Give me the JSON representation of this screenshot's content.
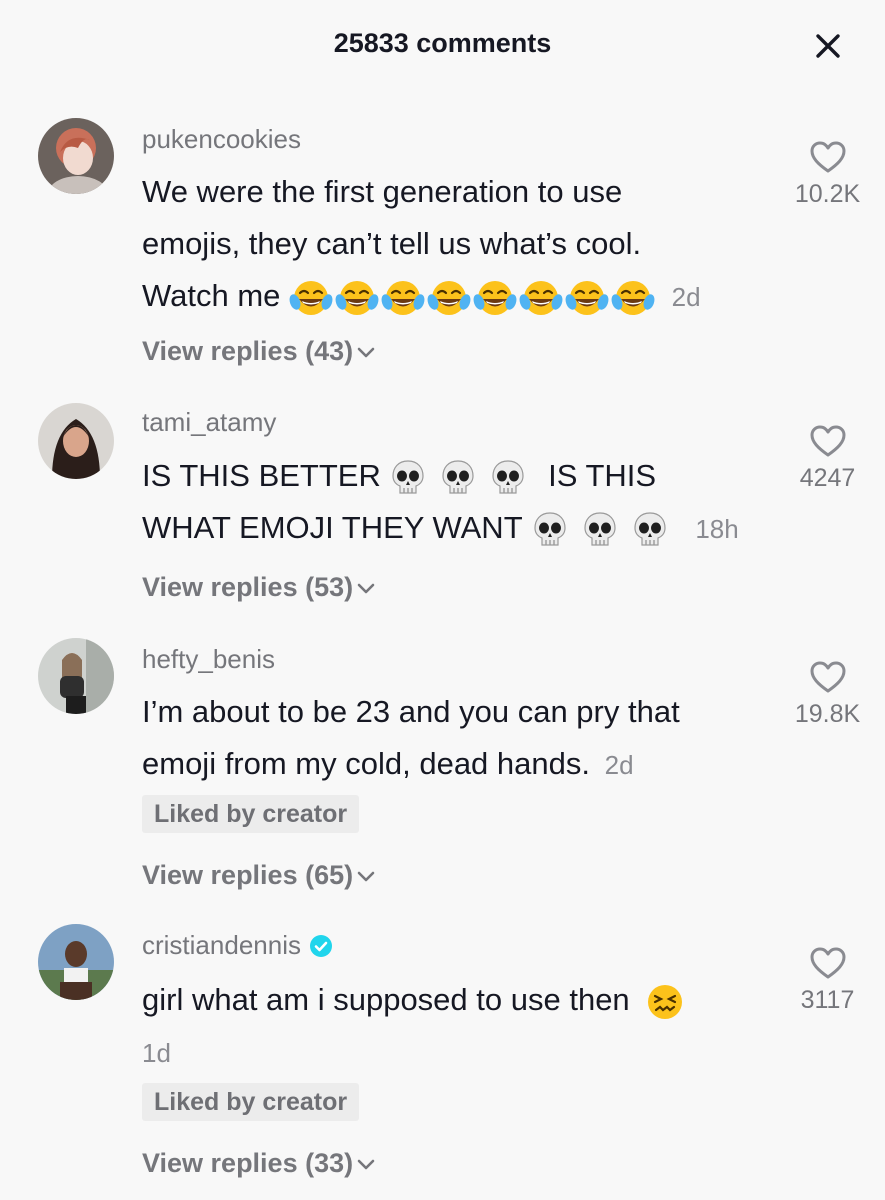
{
  "header": {
    "title": "25833 comments"
  },
  "icons": {
    "close": "close-icon",
    "like": "heart-outline-icon",
    "chevron": "chevron-down-icon",
    "verified": "verified-badge-icon"
  },
  "colors": {
    "verified": "#20d5ec",
    "text": "#161823",
    "muted": "#75767b"
  },
  "comments": [
    {
      "username": "pukencookies",
      "text_lines": [
        "We were the first generation to use",
        "emojis, they can’t tell us what’s cool.",
        "Watch me"
      ],
      "emoji": "face-with-tears-of-joy",
      "emoji_count": 8,
      "time": "2d",
      "likes": "10.2K",
      "view_replies": "View replies (43)",
      "liked_by_creator": null
    },
    {
      "username": "tami_atamy",
      "text_parts": [
        "IS THIS BETTER",
        "IS THIS",
        "WHAT EMOJI THEY WANT"
      ],
      "emoji": "skull",
      "time": "18h",
      "likes": "4247",
      "view_replies": "View replies (53)",
      "liked_by_creator": null
    },
    {
      "username": "hefty_benis",
      "text_lines": [
        "I’m about to be 23 and you can pry that",
        "emoji from my cold, dead hands."
      ],
      "time": "2d",
      "likes": "19.8K",
      "liked_by_creator": "Liked by creator",
      "view_replies": "View replies (65)"
    },
    {
      "username": "cristiandennis",
      "verified": true,
      "text_lines": [
        "girl what am i supposed to use then"
      ],
      "emoji": "confounded-face",
      "time": "1d",
      "likes": "3117",
      "liked_by_creator": "Liked by creator",
      "view_replies": "View replies (33)"
    }
  ]
}
